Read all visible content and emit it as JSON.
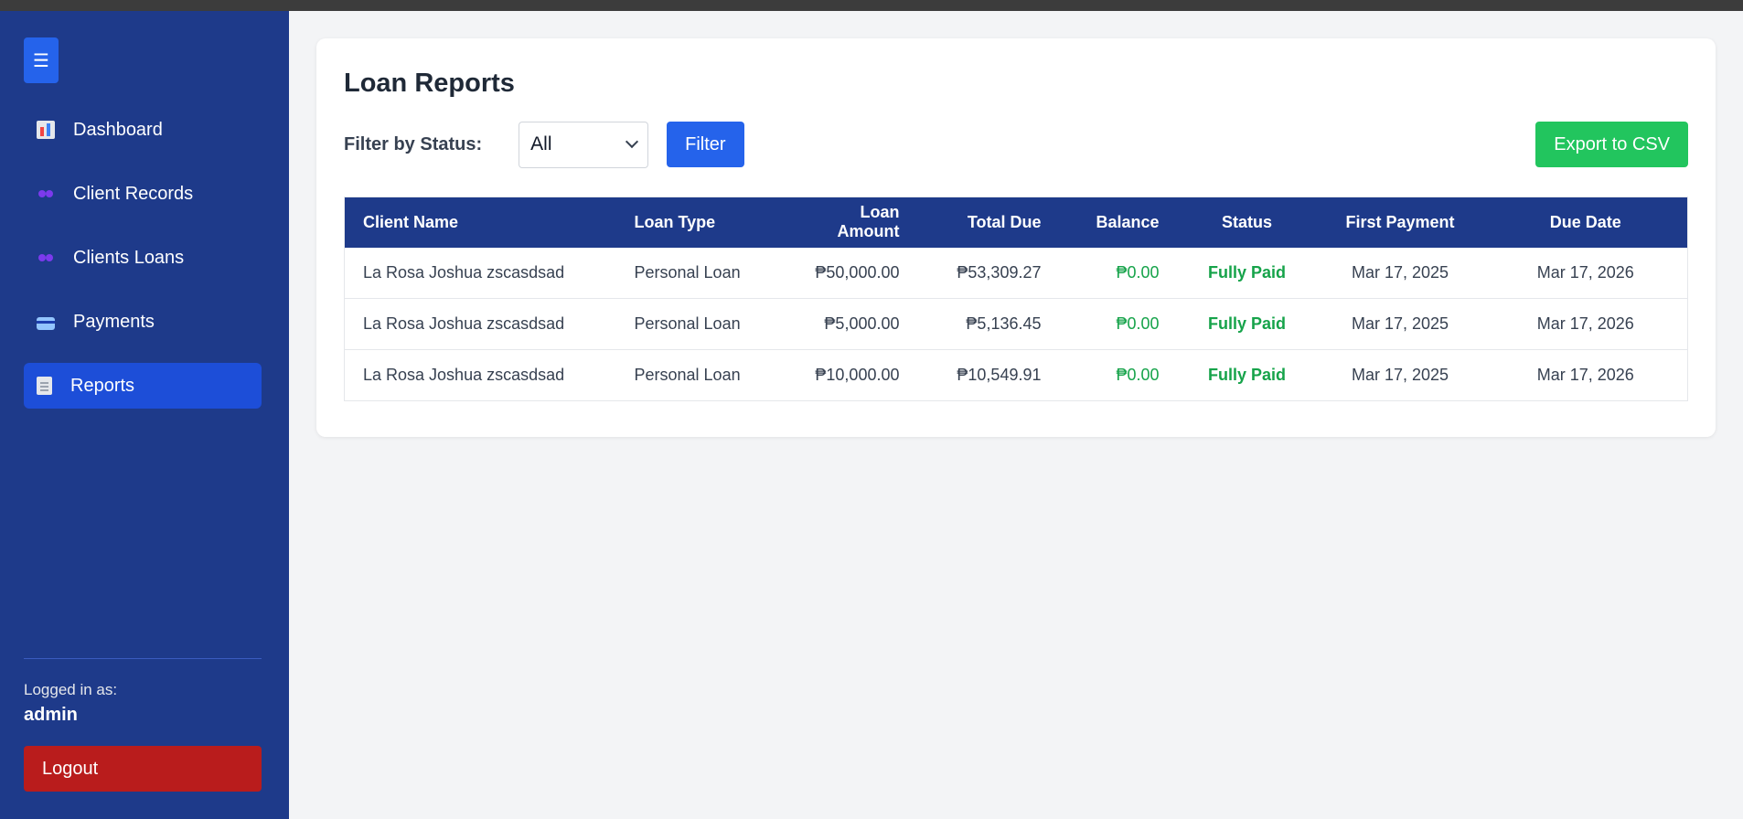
{
  "sidebar": {
    "toggle_icon": "☰",
    "items": [
      {
        "label": "Dashboard",
        "icon": "chart-icon"
      },
      {
        "label": "Client Records",
        "icon": "people-icon"
      },
      {
        "label": "Clients Loans",
        "icon": "people-icon"
      },
      {
        "label": "Payments",
        "icon": "credit-card-icon"
      },
      {
        "label": "Reports",
        "icon": "document-icon",
        "active": true
      }
    ],
    "logged_in_label": "Logged in as:",
    "username": "admin",
    "logout_label": "Logout"
  },
  "page": {
    "title": "Loan Reports",
    "filter_label": "Filter by Status:",
    "status_selected": "All",
    "filter_button": "Filter",
    "export_button": "Export to CSV"
  },
  "table": {
    "headers": [
      "Client Name",
      "Loan Type",
      "Loan Amount",
      "Total Due",
      "Balance",
      "Status",
      "First Payment",
      "Due Date"
    ],
    "rows": [
      {
        "client": "La Rosa Joshua zscasdsad",
        "type": "Personal Loan",
        "amount": "₱50,000.00",
        "total_due": "₱53,309.27",
        "balance": "₱0.00",
        "status": "Fully Paid",
        "first_payment": "Mar 17, 2025",
        "due_date": "Mar 17, 2026"
      },
      {
        "client": "La Rosa Joshua zscasdsad",
        "type": "Personal Loan",
        "amount": "₱5,000.00",
        "total_due": "₱5,136.45",
        "balance": "₱0.00",
        "status": "Fully Paid",
        "first_payment": "Mar 17, 2025",
        "due_date": "Mar 17, 2026"
      },
      {
        "client": "La Rosa Joshua zscasdsad",
        "type": "Personal Loan",
        "amount": "₱10,000.00",
        "total_due": "₱10,549.91",
        "balance": "₱0.00",
        "status": "Fully Paid",
        "first_payment": "Mar 17, 2025",
        "due_date": "Mar 17, 2026"
      }
    ]
  },
  "colors": {
    "sidebar_bg": "#1e3a8a",
    "active_item": "#1d4ed8",
    "primary": "#2563eb",
    "export": "#22c55e",
    "logout": "#b91c1c",
    "paid": "#16a34a"
  }
}
